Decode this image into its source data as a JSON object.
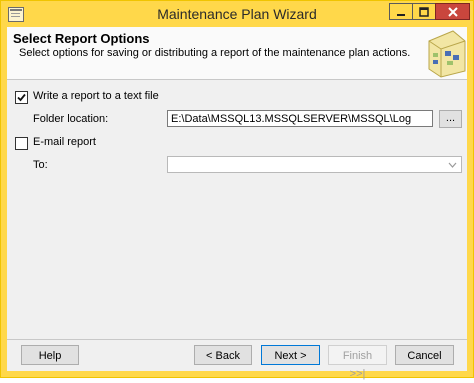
{
  "window": {
    "title": "Maintenance Plan Wizard",
    "accent_color": "#ffd84a",
    "close_color": "#c9463d"
  },
  "header": {
    "title": "Select Report Options",
    "subtitle": "Select options for saving or distributing a report of the maintenance plan actions.",
    "art_icon": "wizard-illustration-icon"
  },
  "options": {
    "write_report": {
      "label": "Write a report to a text file",
      "checked": true
    },
    "folder_location": {
      "label": "Folder location:",
      "value": "E:\\Data\\MSSQL13.MSSQLSERVER\\MSSQL\\Log",
      "browse_label": "..."
    },
    "email_report": {
      "label": "E-mail report",
      "checked": false
    },
    "to": {
      "label": "To:",
      "value": ""
    }
  },
  "buttons": {
    "help": "Help",
    "back": "< Back",
    "next": "Next >",
    "finish": "Finish >>|",
    "cancel": "Cancel"
  }
}
